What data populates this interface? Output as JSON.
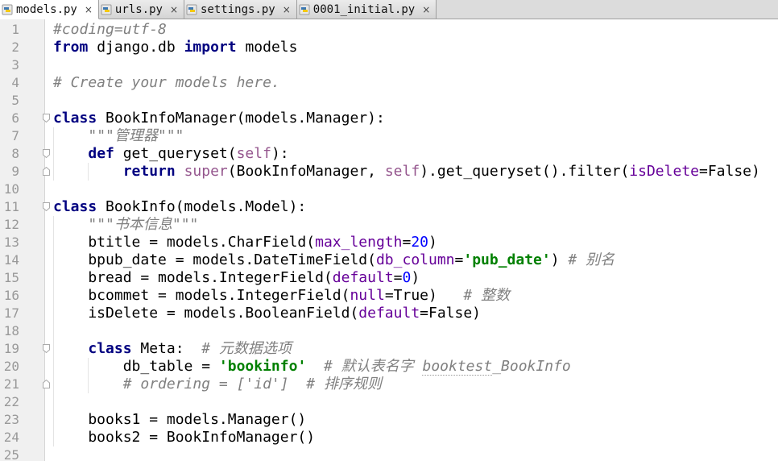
{
  "tabs": [
    {
      "label": "models.py",
      "active": true
    },
    {
      "label": "urls.py",
      "active": false
    },
    {
      "label": "settings.py",
      "active": false
    },
    {
      "label": "0001_initial.py",
      "active": false
    }
  ],
  "tab_close_glyph": "×",
  "lines": [
    [
      [
        "cm",
        "#coding=utf-8"
      ]
    ],
    [
      [
        "kw",
        "from"
      ],
      [
        "",
        " django.db "
      ],
      [
        "kw",
        "import"
      ],
      [
        "",
        " models"
      ]
    ],
    [],
    [
      [
        "cm",
        "# Create your models here."
      ]
    ],
    [],
    [
      [
        "kw",
        "class"
      ],
      [
        "",
        " BookInfoManager(models.Manager):"
      ]
    ],
    [
      [
        "",
        "    "
      ],
      [
        "doc",
        "\"\"\"管理器\"\"\""
      ]
    ],
    [
      [
        "",
        "    "
      ],
      [
        "kw",
        "def"
      ],
      [
        "",
        " get_queryset("
      ],
      [
        "self",
        "self"
      ],
      [
        "",
        "):"
      ]
    ],
    [
      [
        "",
        "        "
      ],
      [
        "kw",
        "return"
      ],
      [
        "",
        " "
      ],
      [
        "self",
        "super"
      ],
      [
        "",
        "(BookInfoManager, "
      ],
      [
        "self",
        "self"
      ],
      [
        "",
        ").get_queryset().filter("
      ],
      [
        "param",
        "isDelete"
      ],
      [
        "",
        "=False)"
      ]
    ],
    [],
    [
      [
        "kw",
        "class"
      ],
      [
        "",
        " BookInfo(models.Model):"
      ]
    ],
    [
      [
        "",
        "    "
      ],
      [
        "doc",
        "\"\"\"书本信息\"\"\""
      ]
    ],
    [
      [
        "",
        "    btitle = models.CharField("
      ],
      [
        "param",
        "max_length"
      ],
      [
        "",
        "="
      ],
      [
        "num",
        "20"
      ],
      [
        "",
        ")"
      ]
    ],
    [
      [
        "",
        "    bpub_date = models.DateTimeField("
      ],
      [
        "param",
        "db_column"
      ],
      [
        "",
        "="
      ],
      [
        "str",
        "'pub_date'"
      ],
      [
        "",
        ") "
      ],
      [
        "cm",
        "# 别名"
      ]
    ],
    [
      [
        "",
        "    bread = models.IntegerField("
      ],
      [
        "param",
        "default"
      ],
      [
        "",
        "="
      ],
      [
        "num",
        "0"
      ],
      [
        "",
        ")"
      ]
    ],
    [
      [
        "",
        "    bcommet = models.IntegerField("
      ],
      [
        "param",
        "null"
      ],
      [
        "",
        "=True)   "
      ],
      [
        "cm",
        "# 整数"
      ]
    ],
    [
      [
        "",
        "    isDelete = models.BooleanField("
      ],
      [
        "param",
        "default"
      ],
      [
        "",
        "=False)"
      ]
    ],
    [],
    [
      [
        "",
        "    "
      ],
      [
        "kw",
        "class"
      ],
      [
        "",
        " Meta:  "
      ],
      [
        "cm",
        "# 元数据选项"
      ]
    ],
    [
      [
        "",
        "        db_table = "
      ],
      [
        "str",
        "'bookinfo'"
      ],
      [
        "",
        "  "
      ],
      [
        "cm",
        "# 默认表名字 "
      ],
      [
        "cmu",
        "booktest"
      ],
      [
        "cm",
        "_BookInfo"
      ]
    ],
    [
      [
        "",
        "        "
      ],
      [
        "cm",
        "# ordering = ['id']  # 排序规则"
      ]
    ],
    [],
    [
      [
        "",
        "    books1 = models.Manager()"
      ]
    ],
    [
      [
        "",
        "    books2 = BookInfoManager()"
      ]
    ],
    []
  ],
  "line_numbers": [
    "1",
    "2",
    "3",
    "4",
    "5",
    "6",
    "7",
    "8",
    "9",
    "10",
    "11",
    "12",
    "13",
    "14",
    "15",
    "16",
    "17",
    "18",
    "19",
    "20",
    "21",
    "22",
    "23",
    "24",
    "25"
  ],
  "colors": {
    "keyword": "#000080",
    "string": "#008000",
    "comment": "#808080",
    "number": "#0000ff",
    "self": "#94558d",
    "param": "#660099"
  },
  "icons": {
    "tab": "python-file-icon",
    "tab_close": "close-icon",
    "fold_open": "fold-open-icon",
    "fold_end": "fold-end-icon"
  }
}
